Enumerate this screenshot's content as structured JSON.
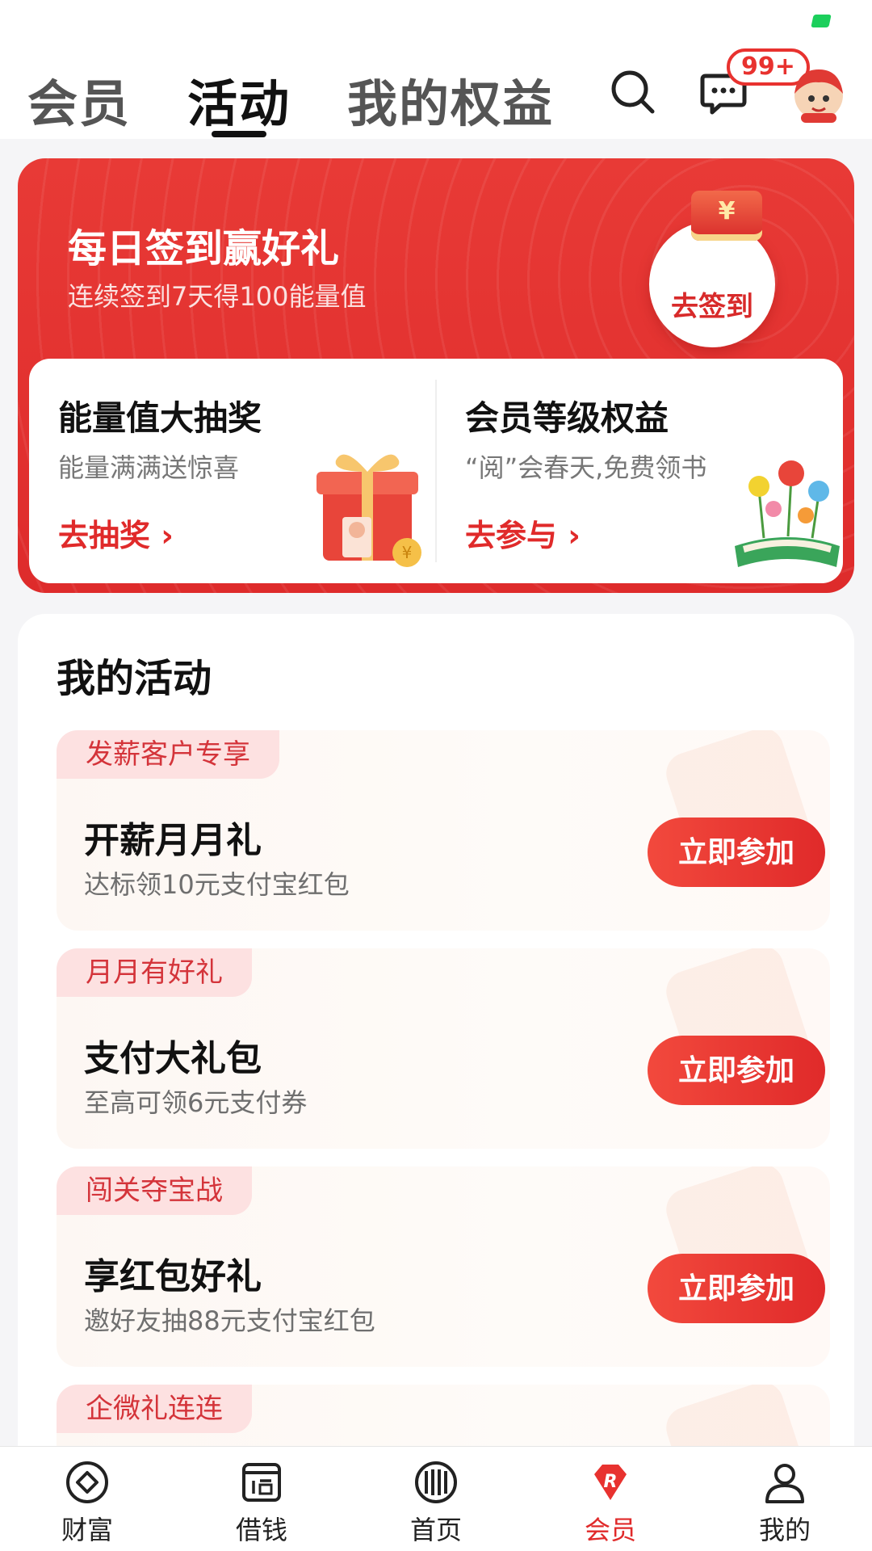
{
  "top_nav": {
    "tabs": [
      {
        "label": "会员"
      },
      {
        "label": "活动",
        "active": true
      },
      {
        "label": "我的权益"
      }
    ],
    "message_badge": "99+",
    "icons": [
      "search-icon",
      "message-icon",
      "mascot-avatar"
    ]
  },
  "checkin": {
    "title": "每日签到赢好礼",
    "subtitle": "连续签到7天得100能量值",
    "button_label": "去签到",
    "coin_symbol": "¥"
  },
  "features": [
    {
      "title": "能量值大抽奖",
      "subtitle": "能量满满送惊喜",
      "link": "去抽奖",
      "arrow": "›"
    },
    {
      "title": "会员等级权益",
      "subtitle": "“阅”会春天,免费领书",
      "link": "去参与",
      "arrow": "›"
    }
  ],
  "activities": {
    "title": "我的活动",
    "items": [
      {
        "tag": "发薪客户专享",
        "title": "开薪月月礼",
        "subtitle": "达标领10元支付宝红包",
        "button": "立即参加"
      },
      {
        "tag": "月月有好礼",
        "title": "支付大礼包",
        "subtitle": "至高可领6元支付券",
        "button": "立即参加"
      },
      {
        "tag": "闯关夺宝战",
        "title": "享红包好礼",
        "subtitle": "邀好友抽88元支付宝红包",
        "button": "立即参加"
      },
      {
        "tag": "企微礼连连",
        "title": "",
        "subtitle": "",
        "button": ""
      }
    ]
  },
  "bottom_tabs": [
    {
      "label": "财富",
      "icon": "wealth-icon"
    },
    {
      "label": "借钱",
      "icon": "borrow-icon"
    },
    {
      "label": "首页",
      "icon": "home-icon"
    },
    {
      "label": "会员",
      "icon": "member-icon",
      "active": true
    },
    {
      "label": "我的",
      "icon": "profile-icon"
    }
  ],
  "colors": {
    "brand_red": "#e02a2a",
    "tag_bg": "#fde1e1",
    "status_green": "#1ccf5c"
  }
}
